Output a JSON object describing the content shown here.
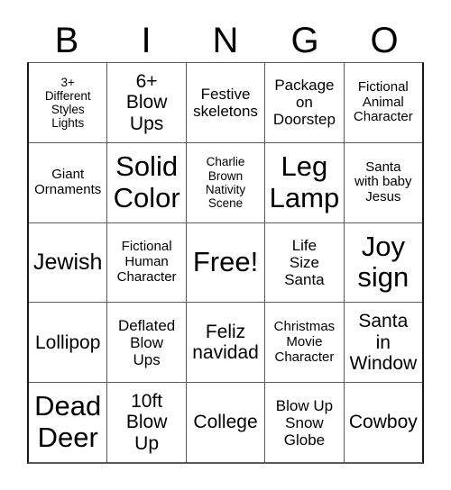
{
  "card": {
    "header_letters": [
      "B",
      "I",
      "N",
      "G",
      "O"
    ],
    "background_color": "#ffffff",
    "text_color": "#000000",
    "border_color": "#5a5a5a",
    "rows": [
      [
        {
          "text": "3+\nDifferent\nStyles\nLights",
          "size": "xs"
        },
        {
          "text": "6+\nBlow\nUps",
          "size": "l"
        },
        {
          "text": "Festive\nskeletons",
          "size": "m"
        },
        {
          "text": "Package\non\nDoorstep",
          "size": "m"
        },
        {
          "text": "Fictional\nAnimal\nCharacter",
          "size": "s"
        }
      ],
      [
        {
          "text": "Giant\nOrnaments",
          "size": "s"
        },
        {
          "text": "Solid\nColor",
          "size": "xxl"
        },
        {
          "text": "Charlie\nBrown\nNativity\nScene",
          "size": "xs"
        },
        {
          "text": "Leg\nLamp",
          "size": "xxl"
        },
        {
          "text": "Santa\nwith baby\nJesus",
          "size": "s"
        }
      ],
      [
        {
          "text": "Jewish",
          "size": "xl"
        },
        {
          "text": "Fictional\nHuman\nCharacter",
          "size": "s"
        },
        {
          "text": "Free!",
          "size": "xxl"
        },
        {
          "text": "Life\nSize\nSanta",
          "size": "m"
        },
        {
          "text": "Joy\nsign",
          "size": "xxl"
        }
      ],
      [
        {
          "text": "Lollipop",
          "size": "l"
        },
        {
          "text": "Deflated\nBlow\nUps",
          "size": "m"
        },
        {
          "text": "Feliz\nnavidad",
          "size": "l"
        },
        {
          "text": "Christmas\nMovie\nCharacter",
          "size": "s"
        },
        {
          "text": "Santa\nin\nWindow",
          "size": "l"
        }
      ],
      [
        {
          "text": "Dead\nDeer",
          "size": "xxl"
        },
        {
          "text": "10ft\nBlow\nUp",
          "size": "l"
        },
        {
          "text": "College",
          "size": "l"
        },
        {
          "text": "Blow Up\nSnow\nGlobe",
          "size": "m"
        },
        {
          "text": "Cowboy",
          "size": "l"
        }
      ]
    ]
  }
}
